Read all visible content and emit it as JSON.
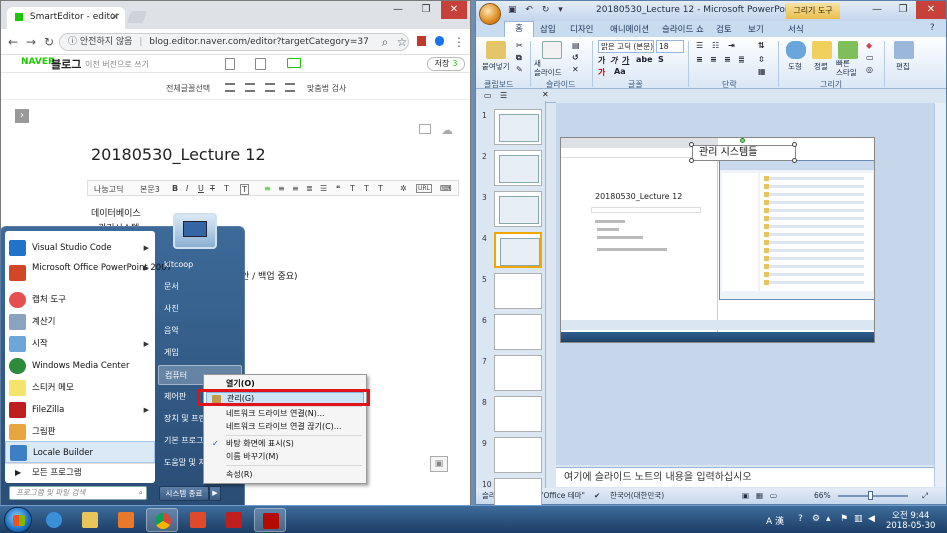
{
  "chrome": {
    "tab_title": "SmartEditor - editor",
    "tab_close": "×",
    "minimize": "—",
    "maximize": "❐",
    "close": "✕",
    "security_text": "안전하지 않음",
    "url": "blog.editor.naver.com/editor?targetCategory=37"
  },
  "editor": {
    "naver_logo": "NAVER",
    "blog_label": "블로그",
    "old_version_link": "이전 버전으로 쓰기",
    "save_label": "저장",
    "save_count": "3",
    "select_all": "전체글꼴선택",
    "spellcheck": "맞춤법 검사",
    "font_name": "나눔고딕",
    "font_size": "본문3",
    "title": "20180530_Lecture 12",
    "body_line1": "데이터베이스",
    "body_line2": "관리시스템",
    "body_line3": "안 / 백업 중요)"
  },
  "start_menu": {
    "items": [
      {
        "label": "Visual Studio Code",
        "has_arrow": true
      },
      {
        "label": "Microsoft Office PowerPoint 2007",
        "has_arrow": true
      },
      {
        "label": "캡처 도구",
        "has_arrow": false
      },
      {
        "label": "계산기",
        "has_arrow": false
      },
      {
        "label": "시작",
        "has_arrow": true
      },
      {
        "label": "Windows Media Center",
        "has_arrow": false
      },
      {
        "label": "스티커 메모",
        "has_arrow": false
      },
      {
        "label": "FileZilla",
        "has_arrow": true
      },
      {
        "label": "그림판",
        "has_arrow": false
      },
      {
        "label": "Locale Builder",
        "has_arrow": false
      }
    ],
    "all_programs": "모든 프로그램",
    "search_placeholder": "프로그램 및 파일 검색",
    "right_items": [
      "kitcoop",
      "문서",
      "사진",
      "음악",
      "게임",
      "컴퓨터",
      "제어판",
      "장치 및 프린",
      "기본 프로그",
      "도움말 및 지"
    ],
    "shutdown": "시스템 종료"
  },
  "context_menu": {
    "items": [
      {
        "label": "열기(O)",
        "bold": true
      },
      {
        "label": "관리(G)",
        "highlighted": true
      },
      {
        "label": "네트워크 드라이브 연결(N)..."
      },
      {
        "label": "네트워크 드라이브 연결 끊기(C)..."
      },
      {
        "label": "바탕 화면에 표시(S)",
        "checked": true
      },
      {
        "label": "이름 바꾸기(M)"
      },
      {
        "label": "속성(R)"
      }
    ],
    "check_mark": "✓"
  },
  "ppt": {
    "title": "20180530_Lecture 12 - Microsoft PowerPoint",
    "tools_badge": "그리기 도구",
    "tabs": [
      "홈",
      "삽입",
      "디자인",
      "애니메이션",
      "슬라이드 쇼",
      "검토",
      "보기",
      "서식"
    ],
    "ribbon": {
      "paste": "붙여넣기",
      "new_slide": "새\n슬라이드",
      "font_box": "맑은 고딕 (본문)",
      "size_box": "18",
      "shape": "도형",
      "arrange": "정렬",
      "quick_style": "빠른\n스타일",
      "edit": "편집",
      "groups": [
        "클립보드",
        "슬라이드",
        "글꼴",
        "단락",
        "그리기"
      ]
    },
    "thumb_numbers": [
      "1",
      "2",
      "3",
      "4",
      "5",
      "6",
      "7",
      "8",
      "9",
      "10",
      "11"
    ],
    "selected_slide": 4,
    "slide": {
      "mini_title": "20180530_Lecture 12",
      "textbox": "관리 시스템들"
    },
    "notes_placeholder": "여기에 슬라이드 노트의 내용을 입력하십시오",
    "status": {
      "slide_info": "슬라이드 4/58",
      "theme": "\"Office 테마\"",
      "language": "한국어(대한민국)",
      "zoom": "66%"
    }
  },
  "taskbar": {
    "apps": [
      "internet-explorer",
      "file-explorer",
      "media-player",
      "chrome",
      "bandicam",
      "filezilla",
      "acrobat"
    ],
    "ime": "A 漢",
    "time": "오전 9:44",
    "date": "2018-05-30"
  },
  "colors": {
    "naver_green": "#1ec800",
    "highlight_red": "#e0131b",
    "win7_blue": "#3e6c9c"
  }
}
